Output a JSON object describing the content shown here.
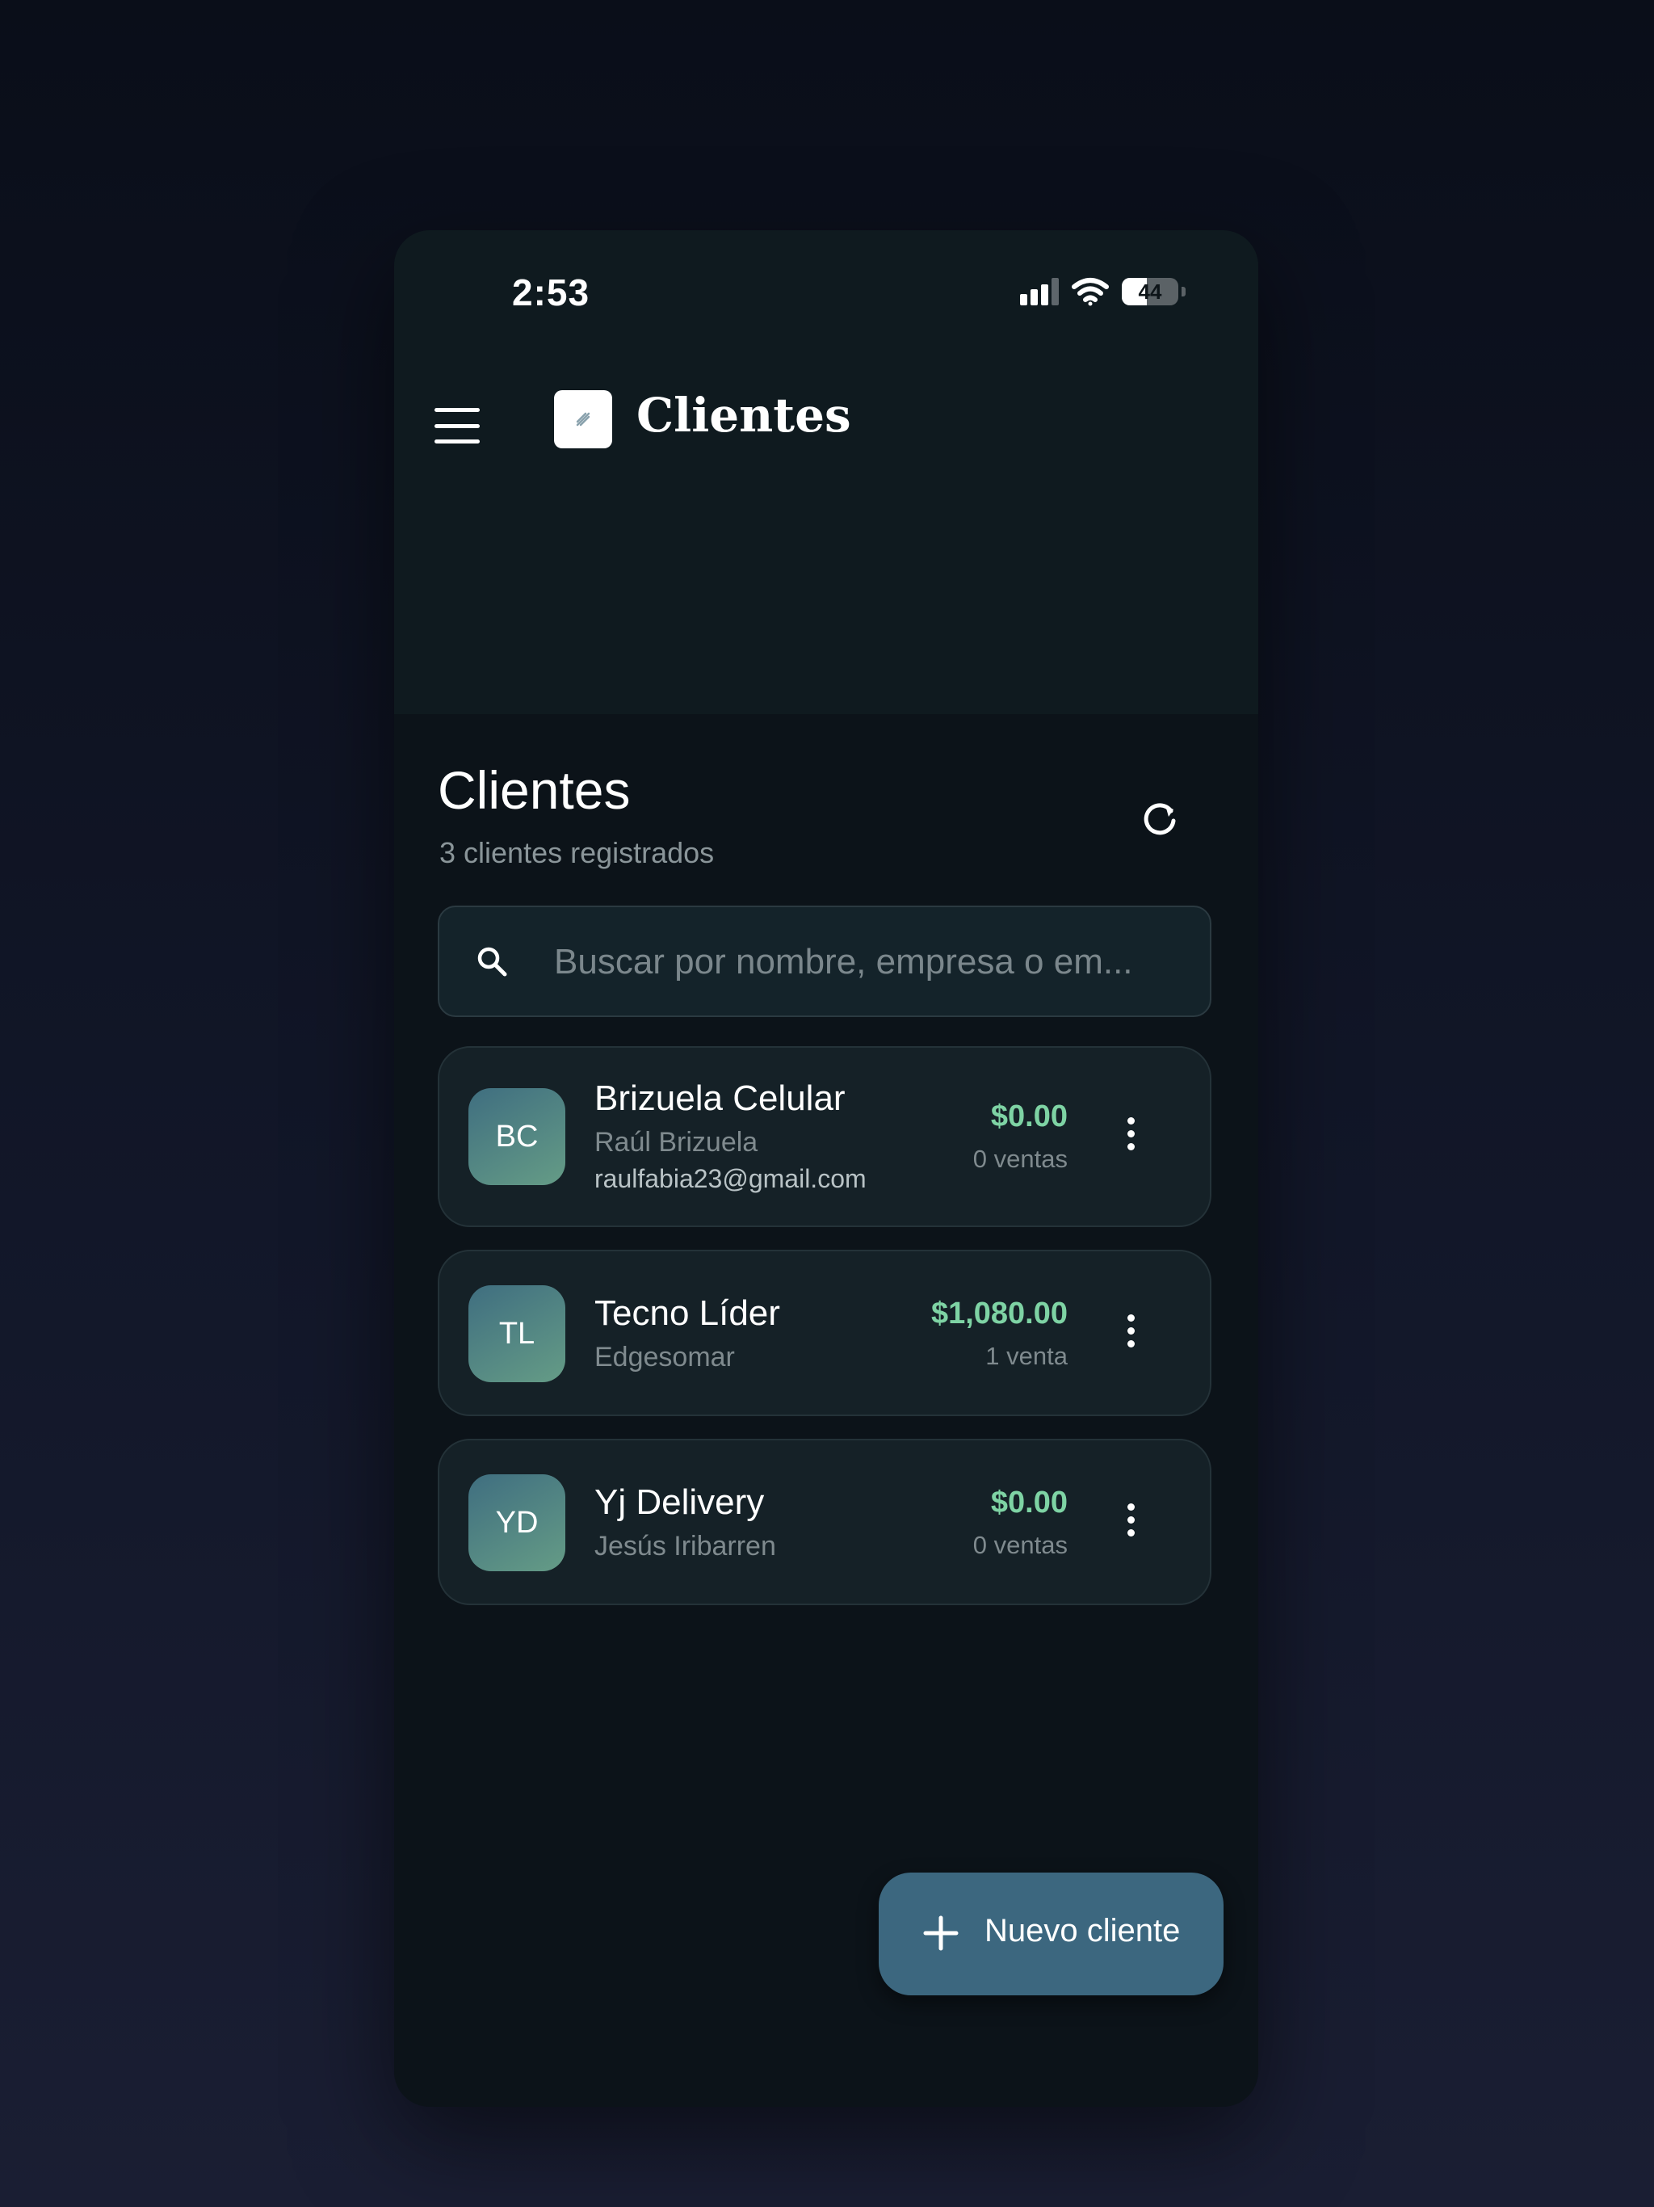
{
  "status_bar": {
    "time": "2:53",
    "battery_level": "44"
  },
  "app_bar": {
    "title": "Clientes",
    "icons": {
      "menu": "hamburger-menu-icon",
      "logo": "app-logo-icon"
    }
  },
  "page": {
    "title": "Clientes",
    "subtitle": "3 clientes registrados",
    "refresh_icon": "refresh-icon"
  },
  "search": {
    "placeholder": "Buscar por nombre, empresa o em...",
    "value": "",
    "icon": "search-icon"
  },
  "clients": [
    {
      "initials": "BC",
      "name": "Brizuela Celular",
      "contact": "Raúl Brizuela",
      "email": "raulfabia23@gmail.com",
      "total": "$0.00",
      "sales": "0 ventas"
    },
    {
      "initials": "TL",
      "name": "Tecno Líder",
      "contact": "Edgesomar",
      "total": "$1,080.00",
      "sales": "1 venta"
    },
    {
      "initials": "YD",
      "name": "Yj Delivery",
      "contact": "Jesús Iribarren",
      "total": "$0.00",
      "sales": "0 ventas"
    }
  ],
  "fab": {
    "label": "Nuevo cliente",
    "icon": "plus-icon"
  },
  "colors": {
    "background": "#0c1319",
    "accent_green": "#7ed3a4",
    "fab": "#3c677f"
  }
}
